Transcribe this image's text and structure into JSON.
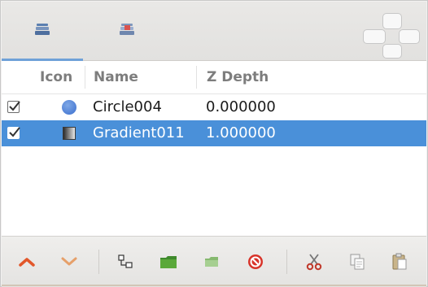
{
  "tabs": [
    {
      "name": "params-tab",
      "icon": "params-panel-icon",
      "active": true
    },
    {
      "name": "library-tab",
      "icon": "library-panel-icon",
      "active": false
    }
  ],
  "columns": {
    "icon": "Icon",
    "name": "Name",
    "zdepth": "Z Depth"
  },
  "layers": [
    {
      "checked": true,
      "icon": "circle-layer-icon",
      "name": "Circle004",
      "zdepth": "0.000000",
      "selected": false
    },
    {
      "checked": true,
      "icon": "gradient-layer-icon",
      "name": "Gradient011",
      "zdepth": "1.000000",
      "selected": true
    }
  ],
  "toolbar": {
    "icons": [
      "raise-layer-icon",
      "lower-layer-icon",
      "encapsulate-icon",
      "group-folder-icon",
      "ungroup-folder-icon",
      "delete-layer-icon",
      "cut-icon",
      "copy-icon",
      "paste-icon"
    ]
  },
  "colors": {
    "selection": "#4a90d9",
    "raise": "#e2572a",
    "lower": "#e6a06a",
    "delete": "#d8342a"
  }
}
